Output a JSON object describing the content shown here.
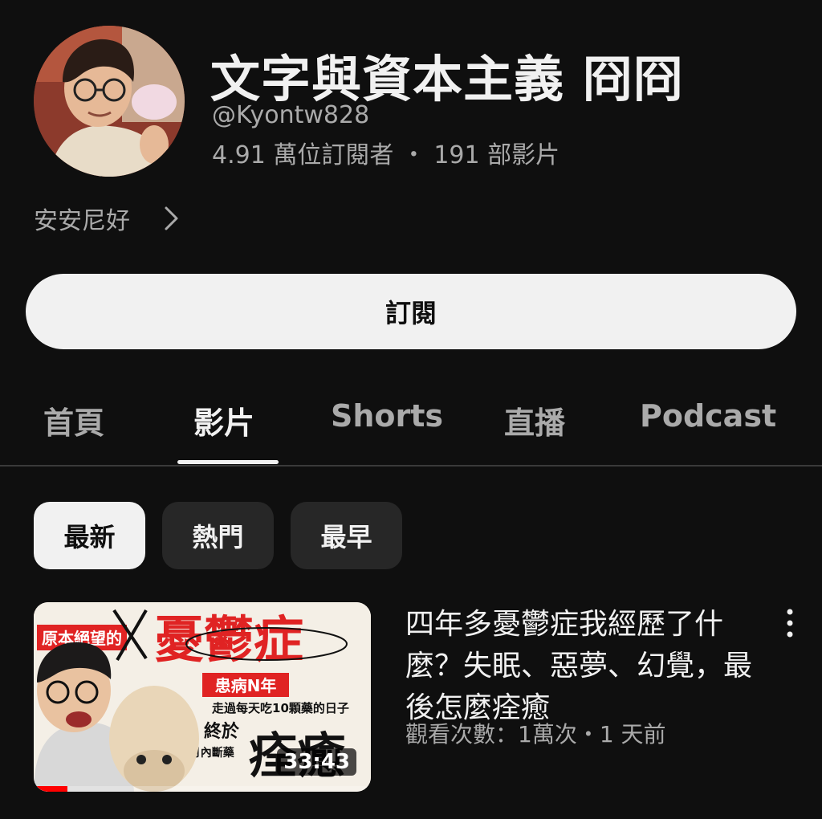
{
  "channel": {
    "title": "文字與資本主義 冏冏",
    "handle": "@Kyontw828",
    "subscribers": "4.91 萬位訂閱者",
    "separator": "・",
    "video_count": "191 部影片",
    "description": "安安尼好"
  },
  "subscribe_label": "訂閱",
  "tabs": [
    {
      "label": "首頁"
    },
    {
      "label": "影片"
    },
    {
      "label": "Shorts"
    },
    {
      "label": "直播"
    },
    {
      "label": "Podcast"
    }
  ],
  "active_tab": "影片",
  "chips": [
    {
      "label": "最新"
    },
    {
      "label": "熱門"
    },
    {
      "label": "最早"
    }
  ],
  "active_chip": "最新",
  "video": {
    "title": "四年多憂鬱症我經歷了什麼？失眠、惡夢、幻覺，最後怎麼痊癒",
    "meta": "觀看次數：1萬次・1 天前",
    "duration": "33:43",
    "watched_fraction": 0.1,
    "thumbnail_text": {
      "tag": "原本絕望的",
      "headline": "憂鬱症",
      "sub1": "患病N年",
      "sub2": "走過每天吃10顆藥的日子",
      "sub3": "終於",
      "sub4": "2個月內斷藥",
      "big": "痊癒"
    }
  },
  "colors": {
    "background": "#0f0f0f",
    "text_primary": "#f1f1f1",
    "text_secondary": "#aaaaaa",
    "chip_bg": "#272727",
    "accent_red": "#ff0000"
  }
}
